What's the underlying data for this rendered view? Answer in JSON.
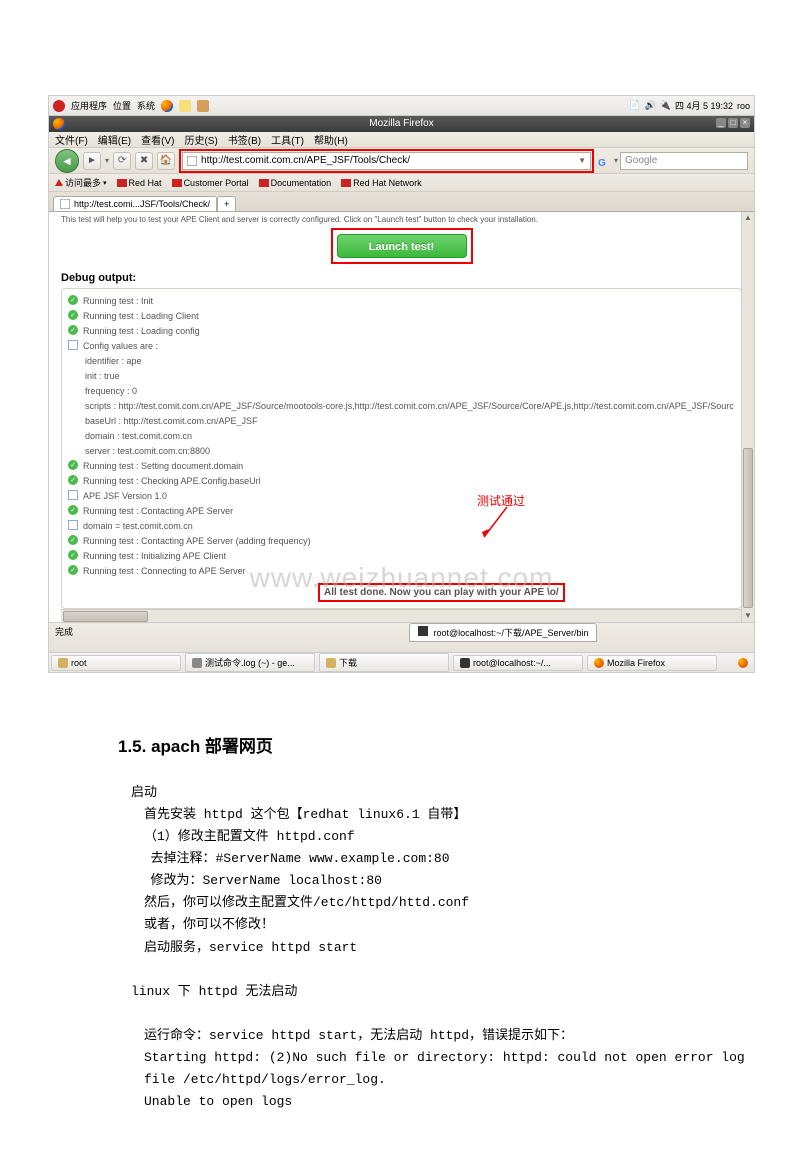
{
  "gnome_top": {
    "apps": "应用程序",
    "places": "位置",
    "system": "系统",
    "date": "四  4月  5 19:32",
    "user": "roo"
  },
  "firefox": {
    "title": "Mozilla Firefox",
    "menus": [
      "文件(F)",
      "编辑(E)",
      "查看(V)",
      "历史(S)",
      "书签(B)",
      "工具(T)",
      "帮助(H)"
    ],
    "url": "http://test.comit.com.cn/APE_JSF/Tools/Check/",
    "search_placeholder": "Google",
    "bookmarks": {
      "most": "访问最多",
      "redhat": "Red Hat",
      "portal": "Customer Portal",
      "docs": "Documentation",
      "rhn": "Red Hat Network"
    },
    "tab_label": "http://test.comi...JSF/Tools/Check/",
    "content": {
      "top_text": "This test will help you to test your APE Client and server is correctly configured. Click on \"Launch test\" button to check your installation.",
      "launch_label": "Launch test!",
      "debug_label": "Debug output:",
      "lines": {
        "l1": "Running test : Init",
        "l2": "Running test : Loading Client",
        "l3": "Running test : Loading config",
        "l4": "Config values are :",
        "l5": "identifier : ape",
        "l6": "init : true",
        "l7": "frequency : 0",
        "l8": "scripts : http://test.comit.com.cn/APE_JSF/Source/mootools-core.js,http://test.comit.com.cn/APE_JSF/Source/Core/APE.js,http://test.comit.com.cn/APE_JSF/Sourc",
        "l9": "baseUrl : http://test.comit.com.cn/APE_JSF",
        "l10": "domain : test.comit.com.cn",
        "l11": "server : test.comit.com.cn:8800",
        "l12": "Running test : Setting document.domain",
        "l13": "Running test : Checking APE.Config.baseUrl",
        "l14": "APE JSF Version 1.0",
        "l15": "Running test : Contacting APE Server",
        "l16": "domain = test.comit.com.cn",
        "l17": "Running test : Contacting APE Server (adding frequency)",
        "l18": "Running test : Initializing APE Client",
        "l19": "Running test : Connecting to APE Server"
      },
      "annotation": "测试通过",
      "result": "All test done. Now you can play with your APE \\o/",
      "watermark": "www.weizhuannet.com"
    },
    "statusbar": {
      "done": "完成",
      "terminal": "root@localhost:~/下载/APE_Server/bin"
    }
  },
  "gnome_bottom": {
    "tasks": {
      "t1": "root",
      "t2": "测试命令.log (~) - ge...",
      "t3": "下载",
      "t4": "root@localhost:~/...",
      "t5": "Mozilla Firefox"
    }
  },
  "doc": {
    "heading": "1.5. apach 部署网页",
    "p1": "启动",
    "p2": "首先安装 httpd 这个包【redhat linux6.1 自带】",
    "p3": "（1）修改主配置文件 httpd.conf",
    "p4": "去掉注释：#ServerName www.example.com:80",
    "p5": "修改为：ServerName localhost:80",
    "p6": "然后，你可以修改主配置文件/etc/httpd/httd.conf",
    "p7": "或者，你可以不修改！",
    "p8": "启动服务，service httpd start",
    "p9": "linux 下 httpd 无法启动",
    "p10": "运行命令：service httpd start，无法启动 httpd，错误提示如下：",
    "p11": "Starting httpd: (2)No such file or directory: httpd: could not open error log file /etc/httpd/logs/error_log.",
    "p12": "Unable to open logs"
  }
}
